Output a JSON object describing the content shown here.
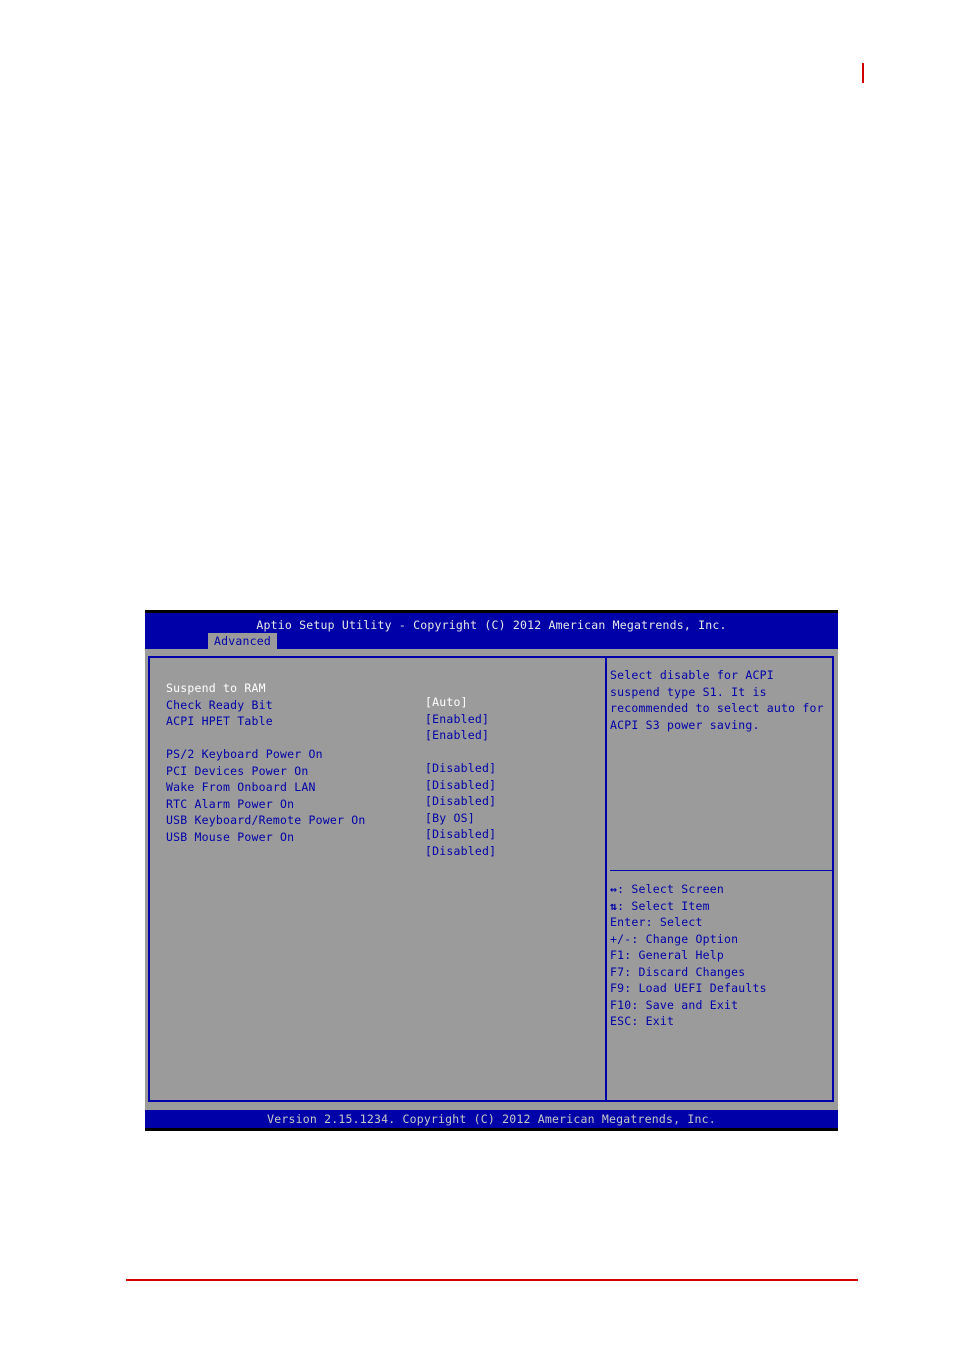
{
  "page": {
    "accent_color": "#d00000"
  },
  "bios": {
    "title": "Aptio Setup Utility - Copyright (C) 2012 American Megatrends, Inc.",
    "active_tab": "Advanced",
    "items": [
      {
        "label": "Suspend to RAM",
        "value": "[Auto]",
        "selected": true
      },
      {
        "label": "Check Ready Bit",
        "value": "[Enabled]",
        "selected": false
      },
      {
        "label": "ACPI HPET Table",
        "value": "[Enabled]",
        "selected": false
      },
      {
        "label": "PS/2 Keyboard Power On",
        "value": "[Disabled]",
        "selected": false
      },
      {
        "label": "PCI Devices Power On",
        "value": "[Disabled]",
        "selected": false
      },
      {
        "label": "Wake From Onboard LAN",
        "value": "[Disabled]",
        "selected": false
      },
      {
        "label": "RTC Alarm Power On",
        "value": "[By OS]",
        "selected": false
      },
      {
        "label": "USB Keyboard/Remote Power On",
        "value": "[Disabled]",
        "selected": false
      },
      {
        "label": "USB Mouse Power On",
        "value": "[Disabled]",
        "selected": false
      }
    ],
    "help_lines": [
      "Select disable for ACPI",
      "suspend type S1. It is",
      "recommended to select auto for",
      "ACPI S3 power saving."
    ],
    "keys": [
      {
        "key": "↔",
        "desc": ": Select Screen"
      },
      {
        "key": "⇅",
        "desc": ": Select Item"
      },
      {
        "key": "Enter",
        "desc": ": Select"
      },
      {
        "key": "+/-",
        "desc": ": Change Option"
      },
      {
        "key": "F1",
        "desc": ": General Help"
      },
      {
        "key": "F7",
        "desc": ": Discard Changes"
      },
      {
        "key": "F9",
        "desc": ": Load UEFI Defaults"
      },
      {
        "key": "F10",
        "desc": ": Save and Exit"
      },
      {
        "key": "ESC",
        "desc": ": Exit"
      }
    ],
    "footer": "Version 2.15.1234. Copyright (C) 2012 American Megatrends, Inc.",
    "colors": {
      "header_blue": "#0000a8",
      "body_gray": "#9b9b9b",
      "selected_text": "#ffffff"
    }
  }
}
